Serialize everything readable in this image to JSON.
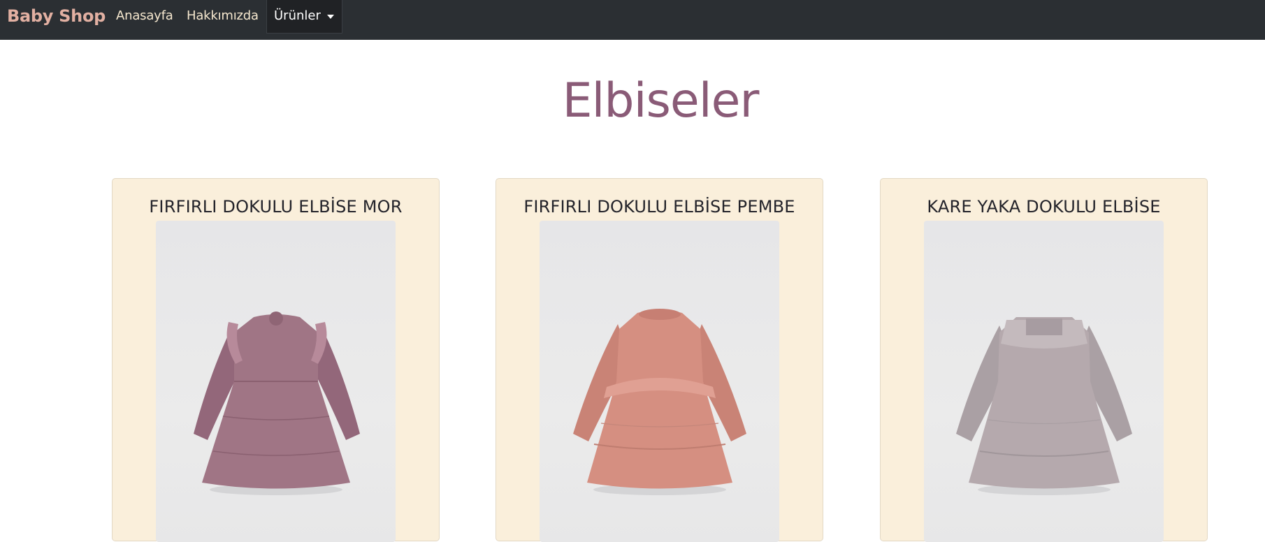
{
  "navbar": {
    "brand": "Baby Shop",
    "links": [
      {
        "label": "Anasayfa"
      },
      {
        "label": "Hakkımızda"
      }
    ],
    "dropdown": {
      "label": "Ürünler"
    }
  },
  "page": {
    "title": "Elbiseler"
  },
  "products": [
    {
      "title": "FIRFIRLI DOKULU ELBİSE MOR",
      "color": "#a07585"
    },
    {
      "title": "FIRFIRLI DOKULU ELBİSE PEMBE",
      "color": "#d58f81"
    },
    {
      "title": "KARE YAKA DOKULU ELBİSE",
      "color": "#b5a9ad"
    }
  ],
  "colors": {
    "navbar_bg": "#2b2f33",
    "brand": "#e2b0a2",
    "title": "#8a5b77",
    "card_bg": "#faefdb"
  }
}
